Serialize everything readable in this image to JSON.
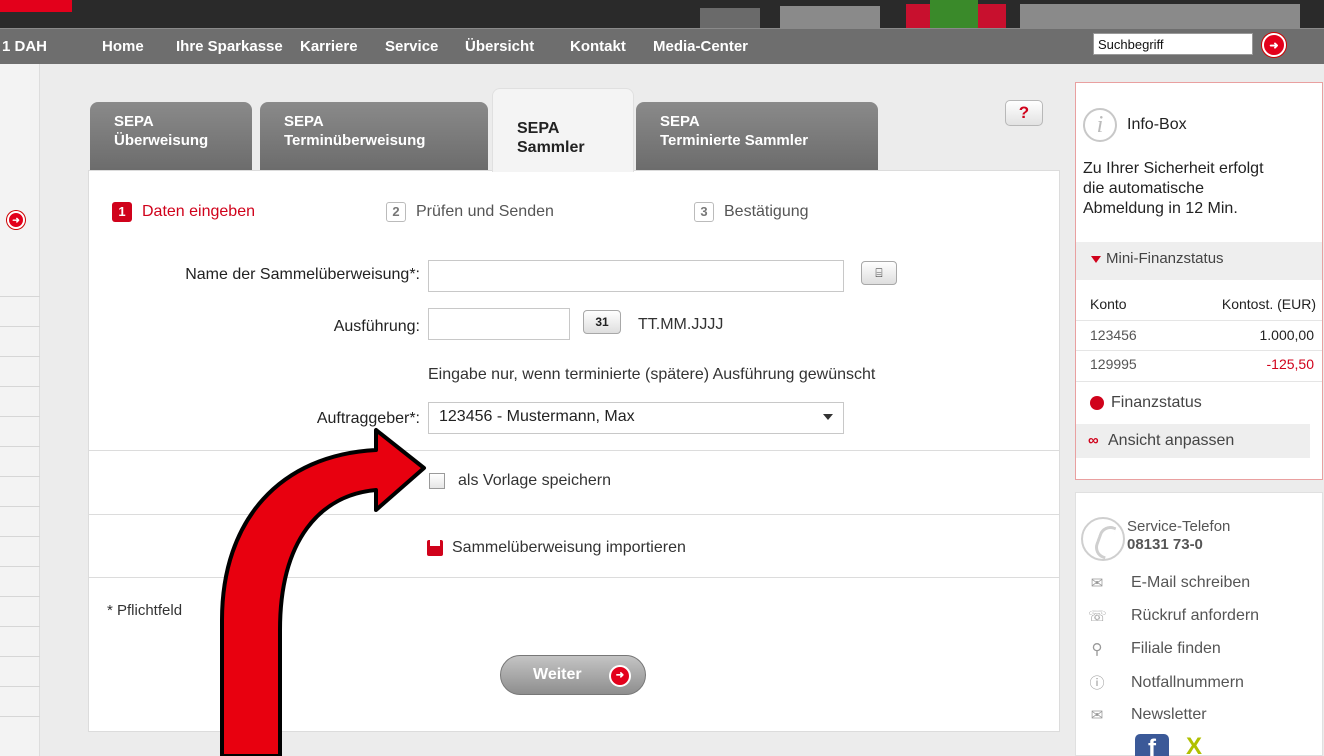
{
  "header": {
    "left_fragment": "1 DAH",
    "nav": [
      "Home",
      "Ihre Sparkasse",
      "Karriere",
      "Service",
      "Übersicht",
      "Kontakt",
      "Media-Center"
    ],
    "search_value": "Suchbegriff"
  },
  "tabs": [
    {
      "line1": "SEPA",
      "line2": "Überweisung",
      "active": false
    },
    {
      "line1": "SEPA",
      "line2": "Terminüberweisung",
      "active": false
    },
    {
      "line1": "SEPA",
      "line2": "Sammler",
      "active": true
    },
    {
      "line1": "SEPA",
      "line2": "Terminierte Sammler",
      "active": false
    }
  ],
  "help_label": "?",
  "steps": [
    {
      "num": "1",
      "label": "Daten eingeben",
      "active": true
    },
    {
      "num": "2",
      "label": "Prüfen und Senden",
      "active": false
    },
    {
      "num": "3",
      "label": "Bestätigung",
      "active": false
    }
  ],
  "form": {
    "name_label": "Name der Sammelüberweisung*:",
    "name_value": "",
    "addressbook_glyph": "⌸",
    "execution_label": "Ausführung:",
    "execution_value": "",
    "calendar_glyph": "31",
    "date_format": "TT.MM.JJJJ",
    "execution_hint": "Eingabe nur, wenn terminierte (spätere) Ausführung gewünscht",
    "principal_label": "Auftraggeber*:",
    "principal_value": "123456 - Mustermann, Max",
    "save_template_label": "als Vorlage speichern",
    "save_template_checked": false,
    "import_label": "Sammelüberweisung importieren",
    "required_note": "* Pflichtfeld",
    "next_button": "Weiter"
  },
  "infobox": {
    "title": "Info-Box",
    "info_icon": "i",
    "message_line1": "Zu Ihrer Sicherheit erfolgt",
    "message_line2": "die automatische",
    "message_line3": "Abmeldung in 12 Min.",
    "finanz_header": "Mini-Finanzstatus",
    "col_account": "Konto",
    "col_balance": "Kontost. (EUR)",
    "accounts": [
      {
        "konto": "123456",
        "balance": "1.000,00",
        "color": "#222222"
      },
      {
        "konto": "129995",
        "balance": "-125,50",
        "color": "#d0021b"
      }
    ],
    "finanzstatus_link": "Finanzstatus",
    "adjust_view_link": "Ansicht anpassen"
  },
  "service": {
    "title": "Service-Telefon",
    "phone": "08131 73-0",
    "links": [
      {
        "icon": "mail-icon",
        "glyph": "✉",
        "label": "E-Mail schreiben"
      },
      {
        "icon": "callback-phone-icon",
        "glyph": "☏",
        "label": "Rückruf anfordern"
      },
      {
        "icon": "magnifier-icon",
        "glyph": "⚲",
        "label": "Filiale finden"
      },
      {
        "icon": "alert-icon",
        "glyph": "ⓘ",
        "label": "Notfallnummern"
      },
      {
        "icon": "newsletter-icon",
        "glyph": "✉",
        "label": "Newsletter"
      }
    ],
    "fb_glyph": "f",
    "xing_glyph": "X"
  },
  "colors": {
    "brand_red": "#e3001b",
    "nav_gray": "#6e6e6e",
    "annotation_arrow": "#e8000f"
  }
}
